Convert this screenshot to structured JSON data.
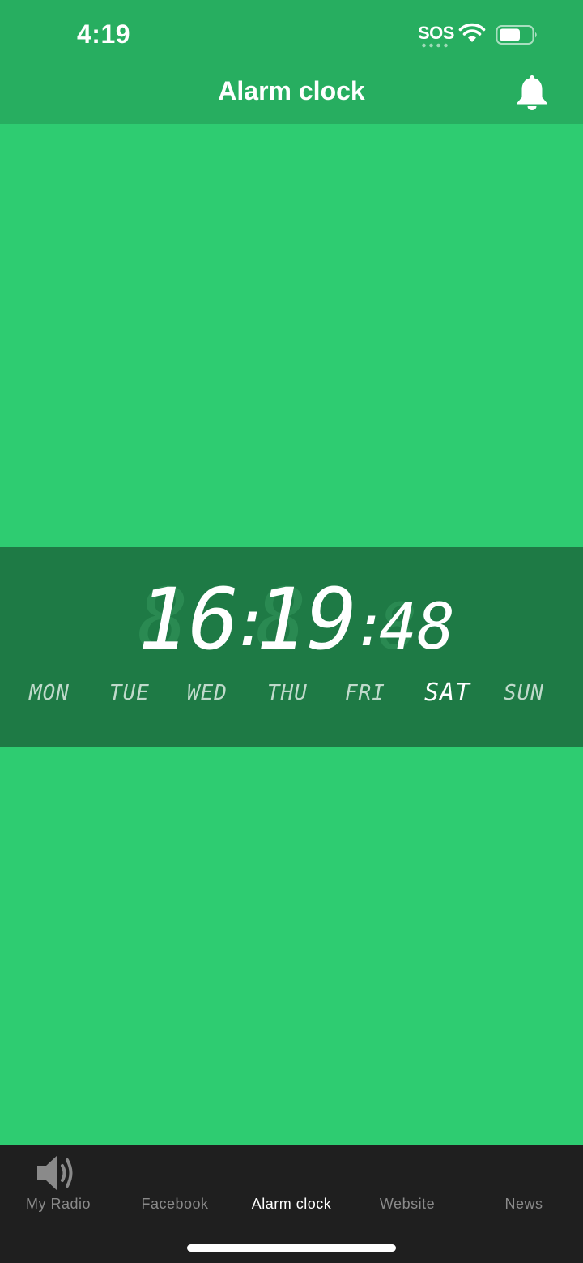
{
  "status_bar": {
    "time": "4:19",
    "carrier_status": "SOS",
    "icons": [
      "wifi-icon",
      "battery-icon"
    ]
  },
  "header": {
    "title": "Alarm clock",
    "icon": "bell-icon"
  },
  "clock": {
    "hours": "16",
    "minutes": "19",
    "seconds": "48",
    "days": [
      {
        "label": "MON",
        "active": false
      },
      {
        "label": "TUE",
        "active": false
      },
      {
        "label": "WED",
        "active": false
      },
      {
        "label": "THU",
        "active": false
      },
      {
        "label": "FRI",
        "active": false
      },
      {
        "label": "SAT",
        "active": true
      },
      {
        "label": "SUN",
        "active": false
      }
    ]
  },
  "tabbar": {
    "tabs": [
      {
        "label": "My Radio",
        "icon": "speaker-icon",
        "active": false
      },
      {
        "label": "Facebook",
        "active": false
      },
      {
        "label": "Alarm clock",
        "active": true
      },
      {
        "label": "Website",
        "active": false
      },
      {
        "label": "News",
        "active": false
      }
    ]
  },
  "colors": {
    "header": "#27ae60",
    "background": "#2ecc71",
    "clock_band": "#1e7a45",
    "tabbar": "#1f1f1f"
  }
}
